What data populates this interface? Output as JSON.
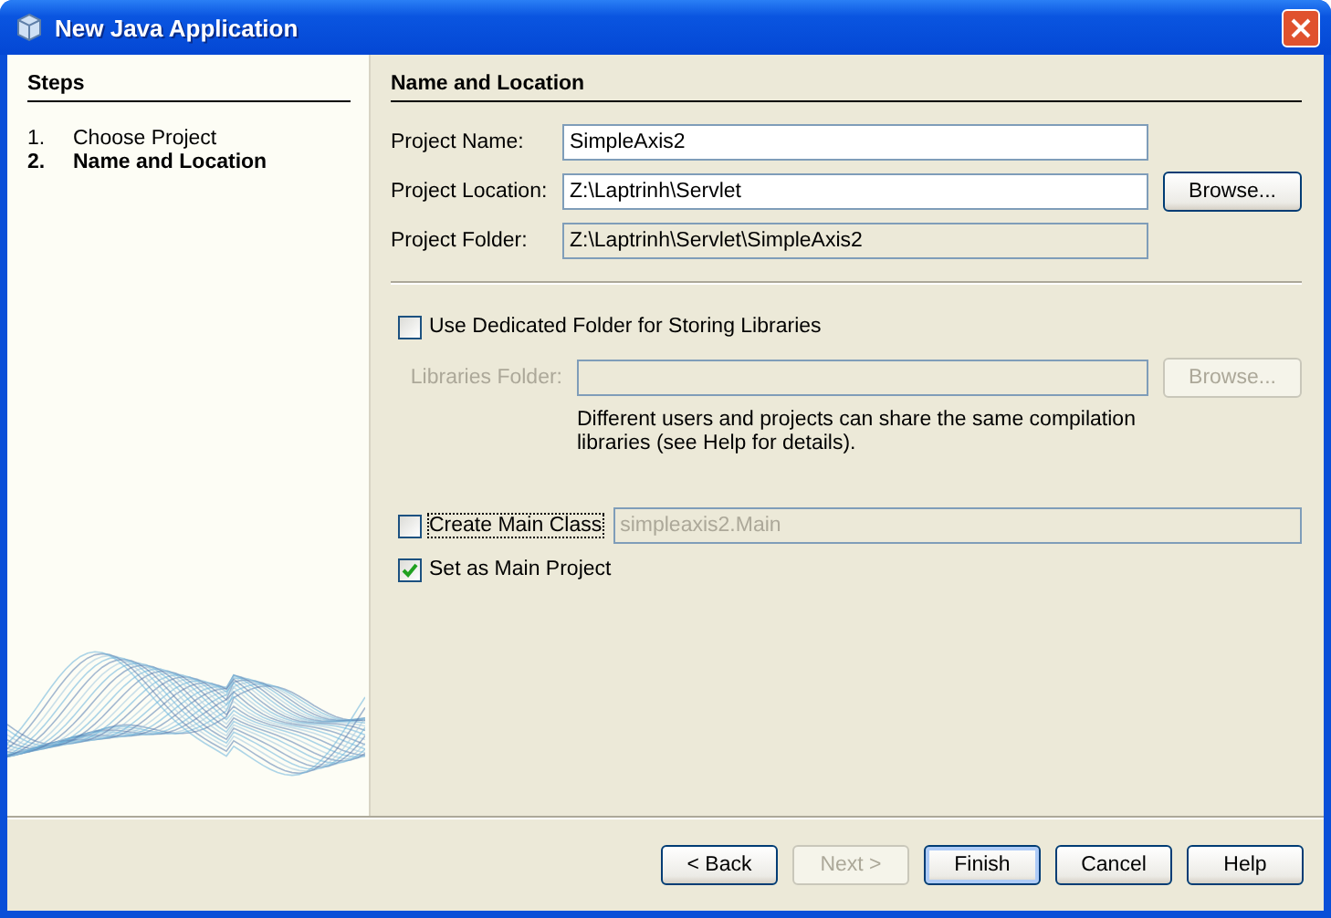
{
  "window": {
    "title": "New Java Application"
  },
  "steps_panel": {
    "title": "Steps",
    "steps": [
      {
        "number": "1.",
        "label": "Choose Project",
        "selected": false
      },
      {
        "number": "2.",
        "label": "Name and Location",
        "selected": true
      }
    ]
  },
  "panel": {
    "title": "Name and Location",
    "fields": [
      {
        "label": "Project Name:",
        "value": "SimpleAxis2",
        "kind": "input"
      },
      {
        "label": "Project Location:",
        "value": "Z:\\Laptrinh\\Servlet",
        "kind": "input",
        "button": {
          "label": "Browse...",
          "disabled": false
        }
      },
      {
        "label": "Project Folder:",
        "value": "Z:\\Laptrinh\\Servlet\\SimpleAxis2",
        "kind": "readonly"
      }
    ],
    "libraries": {
      "checkbox": {
        "label": "Use Dedicated Folder for Storing Libraries",
        "checked": false
      },
      "field": {
        "label": "Libraries Folder:",
        "disabled": true,
        "button": {
          "label": "Browse...",
          "disabled": true
        }
      },
      "note": "Different users and projects can share the same compilation libraries (see Help for details)."
    },
    "main_class": {
      "label": "Create Main Class",
      "checked": false,
      "focused": true,
      "value": "simpleaxis2.Main"
    },
    "main_project": {
      "label": "Set as Main Project",
      "checked": true
    }
  },
  "buttons": [
    {
      "label": "< Back",
      "disabled": false,
      "default": false
    },
    {
      "label": "Next >",
      "disabled": true,
      "default": false
    },
    {
      "label": "Finish",
      "disabled": false,
      "default": true
    },
    {
      "label": "Cancel",
      "disabled": false,
      "default": false
    },
    {
      "label": "Help",
      "disabled": false,
      "default": false
    }
  ]
}
